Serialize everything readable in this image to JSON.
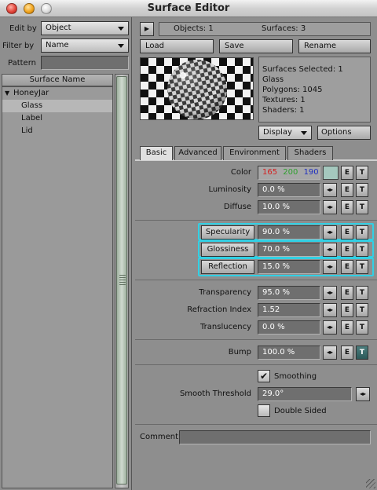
{
  "window": {
    "title": "Surface Editor"
  },
  "left": {
    "edit_by_label": "Edit by",
    "edit_by_value": "Object",
    "filter_by_label": "Filter by",
    "filter_by_value": "Name",
    "pattern_label": "Pattern",
    "pattern_value": "",
    "list_header": "Surface Name",
    "tree": [
      {
        "label": "HoneyJar",
        "expander": "▼"
      },
      {
        "label": "Glass",
        "selected": true
      },
      {
        "label": "Label"
      },
      {
        "label": "Lid"
      }
    ]
  },
  "top": {
    "objects_text": "Objects: 1",
    "surfaces_text": "Surfaces: 3",
    "load_label": "Load",
    "save_label": "Save",
    "rename_label": "Rename"
  },
  "info": {
    "line1": "Surfaces Selected: 1",
    "line2": "Glass",
    "line3": "Polygons: 1045",
    "line4": "Textures: 1",
    "line5": "Shaders: 1"
  },
  "display_label": "Display",
  "options_label": "Options",
  "tabs": [
    {
      "label": "Basic",
      "active": true
    },
    {
      "label": "Advanced"
    },
    {
      "label": "Environment"
    },
    {
      "label": "Shaders"
    }
  ],
  "params": {
    "color": {
      "label": "Color",
      "r": "165",
      "g": "200",
      "b": "190",
      "r_color": "#d42020",
      "g_color": "#2fa02f",
      "b_color": "#2030c0",
      "swatch": "#a5c8be"
    },
    "luminosity": {
      "label": "Luminosity",
      "value": "0.0 %"
    },
    "diffuse": {
      "label": "Diffuse",
      "value": "10.0 %"
    },
    "specularity": {
      "label": "Specularity",
      "value": "90.0 %"
    },
    "glossiness": {
      "label": "Glossiness",
      "value": "70.0 %"
    },
    "reflection": {
      "label": "Reflection",
      "value": "15.0 %"
    },
    "transparency": {
      "label": "Transparency",
      "value": "95.0 %"
    },
    "refraction": {
      "label": "Refraction Index",
      "value": "1.52"
    },
    "translucency": {
      "label": "Translucency",
      "value": "0.0 %"
    },
    "bump": {
      "label": "Bump",
      "value": "100.0 %"
    },
    "smoothing": {
      "label": "Smoothing",
      "checked": true
    },
    "smooth_threshold": {
      "label": "Smooth Threshold",
      "value": "29.0°"
    },
    "double_sided": {
      "label": "Double Sided",
      "checked": false
    },
    "comment": {
      "label": "Comment",
      "value": ""
    }
  },
  "env_e": "E",
  "env_t": "T",
  "env_arrows": "◂▸",
  "highlight_color": "#32d0e4"
}
